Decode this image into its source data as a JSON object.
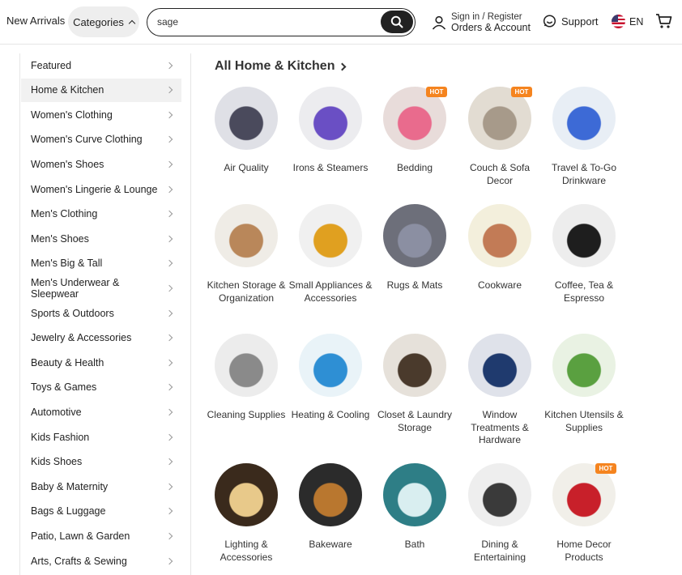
{
  "header": {
    "new_arrivals": "New Arrivals",
    "categories": "Categories",
    "search_value": "sage",
    "sign_in": "Sign in / Register",
    "orders": "Orders & Account",
    "support": "Support",
    "language": "EN"
  },
  "sidebar": {
    "items": [
      {
        "label": "Featured"
      },
      {
        "label": "Home & Kitchen"
      },
      {
        "label": "Women's Clothing"
      },
      {
        "label": "Women's Curve Clothing"
      },
      {
        "label": "Women's Shoes"
      },
      {
        "label": "Women's Lingerie & Lounge"
      },
      {
        "label": "Men's Clothing"
      },
      {
        "label": "Men's Shoes"
      },
      {
        "label": "Men's Big & Tall"
      },
      {
        "label": "Men's Underwear & Sleepwear"
      },
      {
        "label": "Sports & Outdoors"
      },
      {
        "label": "Jewelry & Accessories"
      },
      {
        "label": "Beauty & Health"
      },
      {
        "label": "Toys & Games"
      },
      {
        "label": "Automotive"
      },
      {
        "label": "Kids Fashion"
      },
      {
        "label": "Kids Shoes"
      },
      {
        "label": "Baby & Maternity"
      },
      {
        "label": "Bags & Luggage"
      },
      {
        "label": "Patio, Lawn & Garden"
      },
      {
        "label": "Arts, Crafts & Sewing"
      }
    ],
    "active_index": 1
  },
  "main": {
    "title": "All Home & Kitchen",
    "hot_label": "HOT",
    "tiles": [
      {
        "label": "Air Quality",
        "hot": false,
        "colors": [
          "#dfe0e6",
          "#4a4a5c"
        ]
      },
      {
        "label": "Irons & Steamers",
        "hot": false,
        "colors": [
          "#ececef",
          "#6a4fc4"
        ]
      },
      {
        "label": "Bedding",
        "hot": true,
        "colors": [
          "#e8dcda",
          "#e96b8d"
        ]
      },
      {
        "label": "Couch & Sofa Decor",
        "hot": true,
        "colors": [
          "#e2dcd2",
          "#a79a8a"
        ]
      },
      {
        "label": "Travel & To-Go Drinkware",
        "hot": false,
        "colors": [
          "#e8eef5",
          "#3d6ad6"
        ]
      },
      {
        "label": "Kitchen Storage & Organization",
        "hot": false,
        "colors": [
          "#efece6",
          "#b9875a"
        ]
      },
      {
        "label": "Small Appliances & Accessories",
        "hot": false,
        "colors": [
          "#f0f0f0",
          "#e0a020"
        ]
      },
      {
        "label": "Rugs & Mats",
        "hot": false,
        "colors": [
          "#6d6f7a",
          "#8b8fa2"
        ]
      },
      {
        "label": "Cookware",
        "hot": false,
        "colors": [
          "#f3efdc",
          "#c27b56"
        ]
      },
      {
        "label": "Coffee, Tea & Espresso",
        "hot": false,
        "colors": [
          "#ededed",
          "#1e1e1e"
        ]
      },
      {
        "label": "Cleaning Supplies",
        "hot": false,
        "colors": [
          "#ececec",
          "#8a8a8a"
        ]
      },
      {
        "label": "Heating & Cooling",
        "hot": false,
        "colors": [
          "#e9f3f8",
          "#2e8fd4"
        ]
      },
      {
        "label": "Closet & Laundry Storage",
        "hot": false,
        "colors": [
          "#e6e1da",
          "#4a3a2c"
        ]
      },
      {
        "label": "Window Treatments & Hardware",
        "hot": false,
        "colors": [
          "#dfe2ea",
          "#1f3a6e"
        ]
      },
      {
        "label": "Kitchen Utensils & Supplies",
        "hot": false,
        "colors": [
          "#e9f2e3",
          "#5aa040"
        ]
      },
      {
        "label": "Lighting & Accessories",
        "hot": false,
        "colors": [
          "#3a2a1c",
          "#e8c98a"
        ]
      },
      {
        "label": "Bakeware",
        "hot": false,
        "colors": [
          "#2b2b2b",
          "#b9772f"
        ]
      },
      {
        "label": "Bath",
        "hot": false,
        "colors": [
          "#2e7e86",
          "#d9eef0"
        ]
      },
      {
        "label": "Dining & Entertaining",
        "hot": false,
        "colors": [
          "#eeeeee",
          "#3a3a3a"
        ]
      },
      {
        "label": "Home Decor Products",
        "hot": true,
        "colors": [
          "#f1efe9",
          "#c8202a"
        ]
      }
    ]
  }
}
